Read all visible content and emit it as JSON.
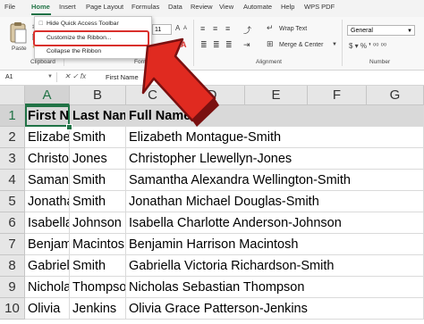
{
  "ribbon_tabs": [
    "File",
    "Home",
    "Insert",
    "Page Layout",
    "Formulas",
    "Data",
    "Review",
    "View",
    "Automate",
    "Help",
    "WPS PDF"
  ],
  "active_tab": "Home",
  "ribbon": {
    "paste_label": "Paste",
    "font_size": "11",
    "wrap_text": "Wrap Text",
    "merge_center": "Merge & Center",
    "number_format": "General",
    "groups": [
      "Clipboard",
      "Font",
      "Alignment",
      "Number"
    ]
  },
  "context_menu": {
    "items": [
      "Hide Quick Access Toolbar",
      "Customize the Ribbon...",
      "Collapse the Ribbon"
    ],
    "highlighted": "Customize the Ribbon...",
    "highlight_color": "#d9302c"
  },
  "formula_bar": {
    "name_box": "A1",
    "fx_icons": "✕ ✓ fx",
    "content": "First Name"
  },
  "sheet": {
    "columns": [
      "A",
      "B",
      "C",
      "D",
      "E",
      "F",
      "G"
    ],
    "rows": [
      "1",
      "2",
      "3",
      "4",
      "5",
      "6",
      "7",
      "8",
      "9",
      "10"
    ],
    "header_row": [
      "First Name",
      "Last Name",
      "Full Name"
    ],
    "data": [
      [
        "Elizabeth",
        "Smith",
        "Elizabeth Montague-Smith"
      ],
      [
        "Christopher",
        "Jones",
        "Christopher Llewellyn-Jones"
      ],
      [
        "Samantha",
        "Smith",
        "Samantha Alexandra Wellington-Smith"
      ],
      [
        "Jonathan",
        "Smith",
        "Jonathan Michael Douglas-Smith"
      ],
      [
        "Isabella",
        "Johnson",
        "Isabella Charlotte Anderson-Johnson"
      ],
      [
        "Benjamin",
        "Macintosh",
        "Benjamin Harrison Macintosh"
      ],
      [
        "Gabriel",
        "Smith",
        "Gabriella Victoria Richardson-Smith"
      ],
      [
        "Nicholas",
        "Thompson",
        "Nicholas Sebastian Thompson"
      ],
      [
        "Olivia",
        "Jenkins",
        "Olivia Grace Patterson-Jenkins"
      ]
    ],
    "accent_color": "#217346"
  }
}
